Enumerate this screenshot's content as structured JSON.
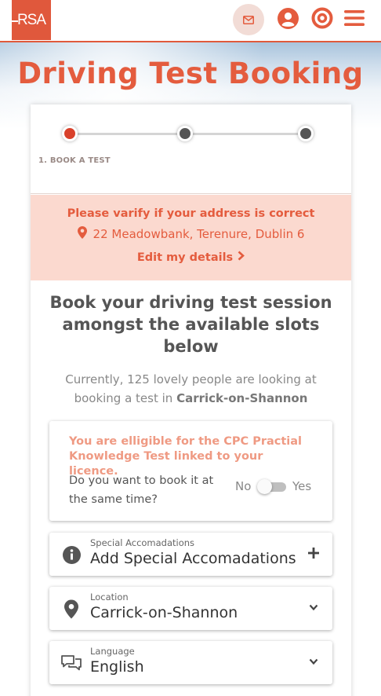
{
  "header": {
    "logo_text": "RSA",
    "mail_icon": "envelope-icon",
    "user_icon": "user-circle-icon",
    "target_icon": "target-icon",
    "menu_icon": "hamburger-menu-icon",
    "accent_color": "#e45c3e"
  },
  "page": {
    "title": "Driving Test Booking"
  },
  "steps": {
    "current_label": "1. BOOK A TEST",
    "active_color": "#d9412b",
    "inactive_color": "#555555"
  },
  "address": {
    "warning": "Please varify if your address is correct",
    "address_line": "22 Meadowbank, Terenure, Dublin 6",
    "edit_label": "Edit my details",
    "pin_icon": "map-marker-icon",
    "chevron_icon": "chevron-right-icon"
  },
  "booking": {
    "heading": "Book your driving test session amongst the available slots below",
    "people_prefix": "Currently, 125 lovely people are looking at booking a test in",
    "people_location": "Carrick-on-Shannon"
  },
  "cpc": {
    "title": "You are elligible for the CPC Practial Knowledge Test linked to your licence.",
    "question": "Do you want to book it at the same time?",
    "toggle_no": "No",
    "toggle_yes": "Yes",
    "toggle_on": false
  },
  "fields": {
    "special": {
      "label": "Special Accomadations",
      "value": "Add Special Accomadations",
      "icon": "info-circle-icon",
      "action_icon": "plus-icon"
    },
    "location": {
      "label": "Location",
      "value": "Carrick-on-Shannon",
      "icon": "map-marker-icon",
      "action_icon": "chevron-down-icon"
    },
    "language": {
      "label": "Language",
      "value": "English",
      "icon": "speech-bubbles-icon",
      "action_icon": "chevron-down-icon"
    }
  }
}
